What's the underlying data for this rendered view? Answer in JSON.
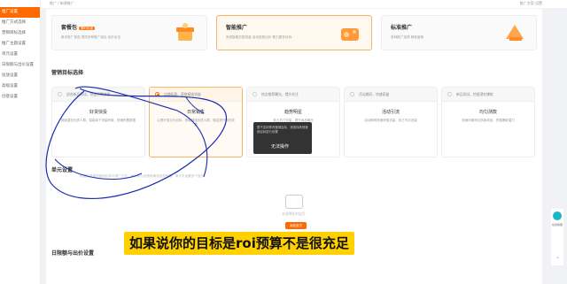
{
  "sidebar": {
    "items": [
      {
        "label": "推广设置",
        "active": true
      },
      {
        "label": "推广方式选择",
        "active": false
      },
      {
        "label": "营销目标选择",
        "active": false
      },
      {
        "label": "推广主题设置",
        "active": false
      },
      {
        "label": "单元设置",
        "active": false
      },
      {
        "label": "日限额与出价设置",
        "active": false
      },
      {
        "label": "投放设置",
        "active": false
      },
      {
        "label": "高级设置",
        "active": false
      },
      {
        "label": "创意设置",
        "active": false
      }
    ]
  },
  "topbar": {
    "left": "推广 / 新建推广",
    "right": "推广方案 设置"
  },
  "promos": [
    {
      "title": "套餐包",
      "tag": "限时优惠",
      "desc": "新手推广首选 提供多种推广组合 优价出击"
    },
    {
      "title": "智能推广",
      "desc": "系统智能匹配流量 自动投放出价 助力更多目标"
    },
    {
      "title": "标准推广",
      "desc": "多种推广选择 精准营销"
    }
  ],
  "sections": {
    "goal_title": "营销目标选择",
    "unit_title": "单元设置",
    "budget_title": "日限额与出价设置"
  },
  "goals": [
    {
      "head": "适合新品测试，快速积累流量",
      "name": "好货快投",
      "desc": "圈选潜在优质人群，智能拿下流量获取，快速积累数据"
    },
    {
      "head": "店铺拓客，获取精准流量",
      "name": "日常销售",
      "desc": "以提升成交为目标，获取精准优质人群，稳定提升转化效果"
    },
    {
      "head": "热点推荐曝光，提升关注",
      "name": "趋势明星",
      "desc": "抢占热门流量，提升商品曝光"
    },
    {
      "head": "活动期间，快速获量",
      "name": "活动引流",
      "desc": "活动期间快速获取流量，抢占节点流量"
    },
    {
      "head": "新品测试，挖掘潜在爆款",
      "name": "均匀测款",
      "desc": "快速均衡测试多款商品，挖掘爆款潜力"
    }
  ],
  "tooltip": {
    "text": "暂不支持修改营销目标，请选择其他营销目标进行设置",
    "status": "无法操作"
  },
  "unit": {
    "hint": "根据您选择的营销目标与推广方式，系统将为您推荐最佳投放策略，单元可设置多个宝贝",
    "empty_text": "未选择任何宝贝",
    "add_button": "添加宝贝"
  },
  "subtitle": "如果说你的目标是roi预算不是很充足",
  "float": {
    "label": "在线客服"
  },
  "colors": {
    "accent": "#ff6a00",
    "subtitle_bg": "#ffd100",
    "pen": "#1a2bb0"
  }
}
